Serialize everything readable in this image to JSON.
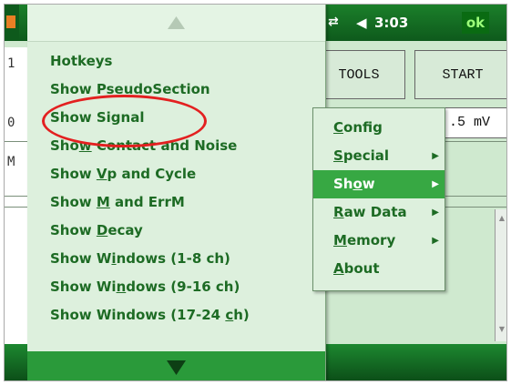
{
  "status_bar": {
    "connectivity_icon": "sync-arrows-icon",
    "volume_icon": "speaker-icon",
    "time": "3:03",
    "ok_label": "ok"
  },
  "background": {
    "tools_label": "TOOLS",
    "start_label": "START",
    "readout_value": ".5 mV",
    "edge_chars": [
      "1",
      "0",
      "M"
    ]
  },
  "menu": {
    "scroll_up_icon": "triangle-up-icon",
    "scroll_down_icon": "triangle-down-icon",
    "items": [
      {
        "pre": "Hotkeys",
        "ul": "",
        "post": ""
      },
      {
        "pre": "Show PseudoSection",
        "ul": "",
        "post": ""
      },
      {
        "pre": "Show Signal",
        "ul": "",
        "post": ""
      },
      {
        "pre": "Sho",
        "ul": "w",
        "post": " Contact and Noise"
      },
      {
        "pre": "Show ",
        "ul": "V",
        "post": "p and Cycle"
      },
      {
        "pre": "Show ",
        "ul": "M",
        "post": " and ErrM"
      },
      {
        "pre": "Show ",
        "ul": "D",
        "post": "ecay"
      },
      {
        "pre": "Show W",
        "ul": "i",
        "post": "ndows (1-8 ch)"
      },
      {
        "pre": "Show Wi",
        "ul": "n",
        "post": "dows (9-16 ch)"
      },
      {
        "pre": "Show Windows (17-24 ",
        "ul": "c",
        "post": "h)"
      }
    ]
  },
  "submenu": {
    "items": [
      {
        "pre": "",
        "ul": "C",
        "post": "onfig",
        "arrow": false
      },
      {
        "pre": "",
        "ul": "S",
        "post": "pecial",
        "arrow": true
      },
      {
        "pre": "Sh",
        "ul": "o",
        "post": "w",
        "arrow": true
      },
      {
        "pre": "",
        "ul": "R",
        "post": "aw Data",
        "arrow": true
      },
      {
        "pre": "",
        "ul": "M",
        "post": "emory",
        "arrow": true
      },
      {
        "pre": "",
        "ul": "A",
        "post": "bout",
        "arrow": false
      }
    ],
    "selected_index": 2,
    "arrow_glyph": "▶"
  },
  "colors": {
    "menu_text": "#1d6b24",
    "selected_bg": "#37a843",
    "title_bar": "#157a26",
    "highlight_ellipse": "#e32020"
  }
}
